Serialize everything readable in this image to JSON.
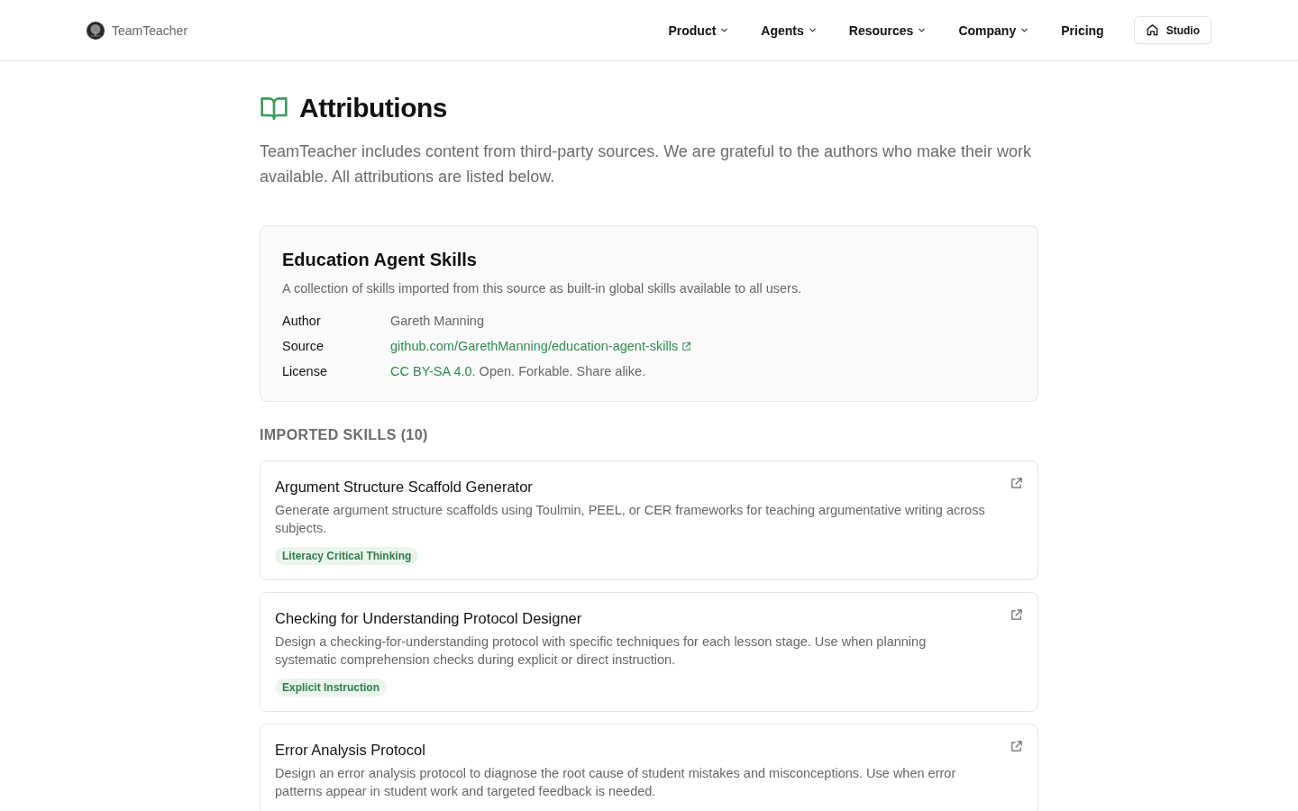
{
  "header": {
    "brand": "TeamTeacher",
    "nav": [
      {
        "label": "Product",
        "dropdown": true
      },
      {
        "label": "Agents",
        "dropdown": true
      },
      {
        "label": "Resources",
        "dropdown": true
      },
      {
        "label": "Company",
        "dropdown": true
      },
      {
        "label": "Pricing",
        "dropdown": false
      }
    ],
    "studio_button": "Studio"
  },
  "page": {
    "title": "Attributions",
    "intro": "TeamTeacher includes content from third-party sources. We are grateful to the authors who make their work available. All attributions are listed below."
  },
  "source": {
    "title": "Education Agent Skills",
    "description": "A collection of skills imported from this source as built-in global skills available to all users.",
    "fields": [
      {
        "kind": "text",
        "label": "Author",
        "value": "Gareth Manning"
      },
      {
        "kind": "external_link",
        "label": "Source",
        "link": "github.com/GarethManning/education-agent-skills"
      },
      {
        "kind": "link_text",
        "label": "License",
        "link": "CC BY-SA 4.0",
        "text": ". Open. Forkable. Share alike."
      }
    ]
  },
  "skills_heading": "IMPORTED SKILLS (10)",
  "skills": [
    {
      "title": "Argument Structure Scaffold Generator",
      "description": "Generate argument structure scaffolds using Toulmin, PEEL, or CER frameworks for teaching argumentative writing across subjects.",
      "tags": [
        "Literacy Critical Thinking"
      ]
    },
    {
      "title": "Checking for Understanding Protocol Designer",
      "description": "Design a checking-for-understanding protocol with specific techniques for each lesson stage. Use when planning systematic comprehension checks during explicit or direct instruction.",
      "tags": [
        "Explicit Instruction"
      ]
    },
    {
      "title": "Error Analysis Protocol",
      "description": "Design an error analysis protocol to diagnose the root cause of student mistakes and misconceptions. Use when error patterns appear in student work and targeted feedback is needed."
    }
  ]
}
